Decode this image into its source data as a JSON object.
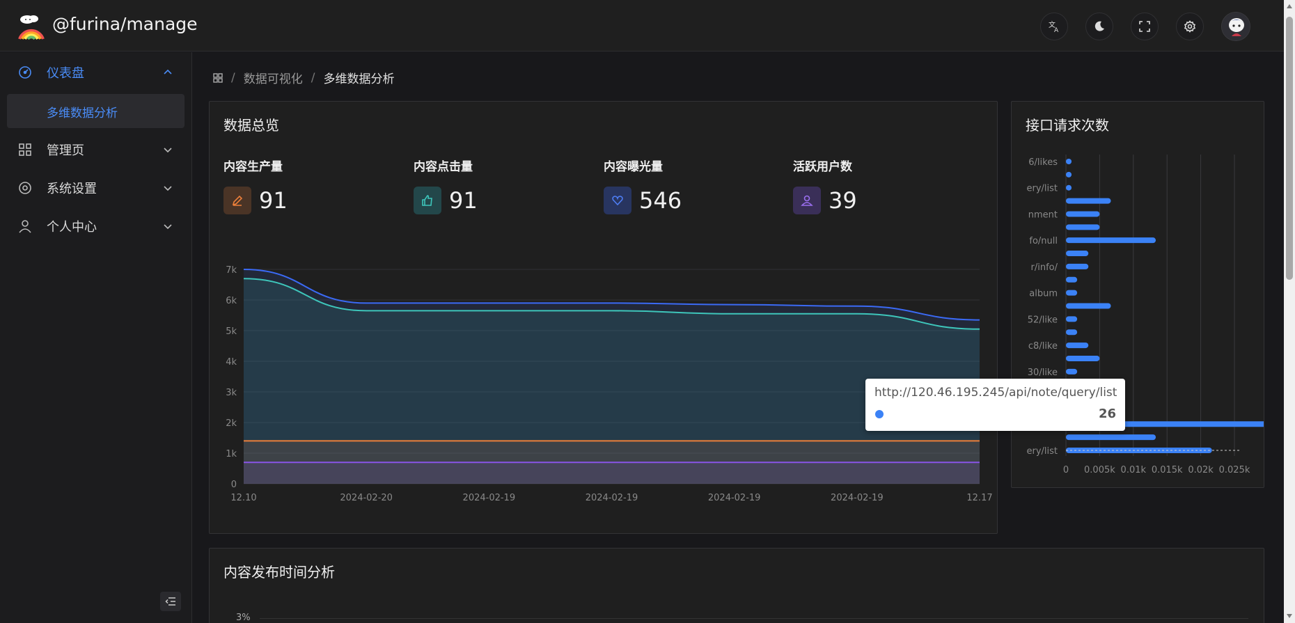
{
  "app": {
    "title": "@furina/manage"
  },
  "header": {
    "buttons": [
      {
        "name": "translate-icon"
      },
      {
        "name": "moon-icon"
      },
      {
        "name": "fullscreen-icon"
      },
      {
        "name": "gear-icon"
      }
    ]
  },
  "sidebar": {
    "items": [
      {
        "label": "仪表盘",
        "icon": "dashboard-icon",
        "expanded": true,
        "active": true
      },
      {
        "label": "管理页",
        "icon": "grid-icon"
      },
      {
        "label": "系统设置",
        "icon": "gear-icon"
      },
      {
        "label": "个人中心",
        "icon": "user-icon"
      }
    ],
    "sub_items": [
      {
        "label": "多维数据分析",
        "active": true
      }
    ]
  },
  "breadcrumb": {
    "items": [
      "数据可视化",
      "多维数据分析"
    ]
  },
  "overview": {
    "title": "数据总览",
    "stats": [
      {
        "label": "内容生产量",
        "value": "91",
        "icon": "pencil-icon",
        "color": "#ec7f3a",
        "bg": "#4a3426"
      },
      {
        "label": "内容点击量",
        "value": "91",
        "icon": "thumbs-up-icon",
        "color": "#3ec6bb",
        "bg": "#23474a"
      },
      {
        "label": "内容曝光量",
        "value": "546",
        "icon": "heart-icon",
        "color": "#4e7ef5",
        "bg": "#283560"
      },
      {
        "label": "活跃用户数",
        "value": "39",
        "icon": "user-icon",
        "color": "#9a6ff0",
        "bg": "#3a2f58"
      }
    ]
  },
  "requests": {
    "title": "接口请求次数"
  },
  "tooltip": {
    "url": "http://120.46.195.245/api/note/query/list",
    "value": "26",
    "color": "#3b82f6"
  },
  "publish": {
    "title": "内容发布时间分析",
    "tick": "3%"
  },
  "chart_data": [
    {
      "type": "area",
      "x": [
        "12.10",
        "2024-02-20",
        "2024-02-19",
        "2024-02-19",
        "2024-02-19",
        "2024-02-19",
        "12.17"
      ],
      "yticks": [
        "0",
        "1k",
        "2k",
        "3k",
        "4k",
        "5k",
        "6k",
        "7k"
      ],
      "ylim": [
        0,
        7000
      ],
      "grid": true,
      "series": [
        {
          "color": "#3b6af5",
          "values": [
            7000,
            5900,
            5900,
            5900,
            5850,
            5800,
            5350
          ]
        },
        {
          "color": "#3ec6bb",
          "values": [
            6700,
            5650,
            5650,
            5650,
            5550,
            5550,
            5050
          ]
        },
        {
          "color": "#ec7f3a",
          "values": [
            1400,
            1400,
            1400,
            1400,
            1400,
            1400,
            1400
          ]
        },
        {
          "color": "#8a55e8",
          "values": [
            700,
            700,
            700,
            700,
            700,
            700,
            700
          ]
        }
      ]
    },
    {
      "type": "bar",
      "orientation": "horizontal",
      "categories": [
        "6/likes",
        "",
        "ery/list",
        "",
        "nment",
        "",
        "fo/null",
        "",
        "r/info/",
        "",
        "album",
        "",
        "52/like",
        "",
        "c8/like",
        "",
        "30/like",
        "",
        "",
        "",
        "",
        "",
        "ery/list"
      ],
      "values": [
        1,
        1,
        1,
        8,
        6,
        6,
        16,
        4,
        4,
        2,
        2,
        8,
        2,
        2,
        4,
        6,
        2,
        3,
        3,
        3,
        46,
        16,
        26
      ],
      "xticks": [
        "0",
        "0.005k",
        "0.01k",
        "0.015k",
        "0.02k",
        "0.025k"
      ],
      "xlim": [
        0,
        30
      ],
      "grid": true,
      "color": "#3b82f6",
      "highlight_index": 22
    }
  ]
}
